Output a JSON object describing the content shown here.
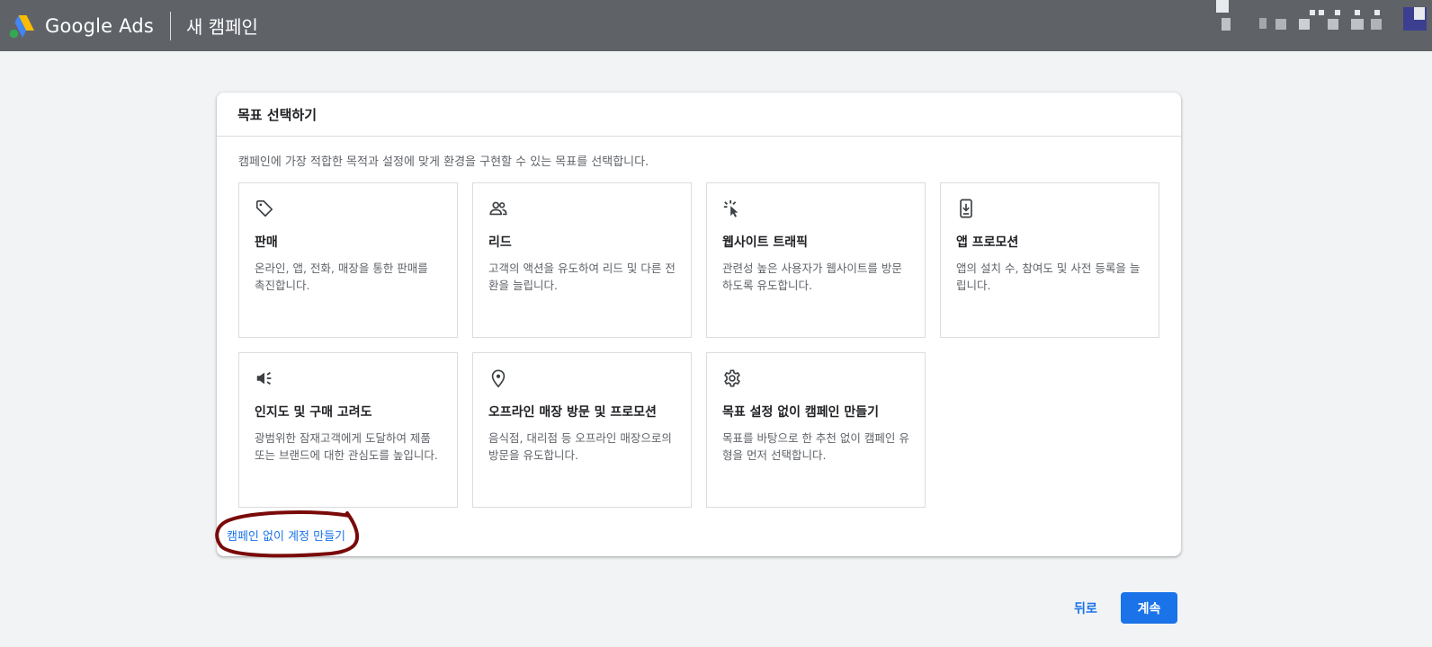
{
  "header": {
    "brand": "Google Ads",
    "subtitle": "새 캠페인"
  },
  "card": {
    "title": "목표 선택하기",
    "description": "캠페인에 가장 적합한 목적과 설정에 맞게 환경을 구현할 수 있는 목표를 선택합니다.",
    "goals": [
      {
        "icon": "tag-icon",
        "title": "판매",
        "text": "온라인, 앱, 전화, 매장을 통한 판매를 촉진합니다."
      },
      {
        "icon": "people-icon",
        "title": "리드",
        "text": "고객의 액션을 유도하여 리드 및 다른 전환을 늘립니다."
      },
      {
        "icon": "cursor-click-icon",
        "title": "웹사이트 트래픽",
        "text": "관련성 높은 사용자가 웹사이트를 방문하도록 유도합니다."
      },
      {
        "icon": "phone-download-icon",
        "title": "앱 프로모션",
        "text": "앱의 설치 수, 참여도 및 사전 등록을 늘립니다."
      },
      {
        "icon": "megaphone-icon",
        "title": "인지도 및 구매 고려도",
        "text": "광범위한 잠재고객에게 도달하여 제품 또는 브랜드에 대한 관심도를 높입니다."
      },
      {
        "icon": "location-pin-icon",
        "title": "오프라인 매장 방문 및 프로모션",
        "text": "음식점, 대리점 등 오프라인 매장으로의 방문을 유도합니다."
      },
      {
        "icon": "gear-icon",
        "title": "목표 설정 없이 캠페인 만들기",
        "text": "목표를 바탕으로 한 추천 없이 캠페인 유형을 먼저 선택합니다."
      }
    ],
    "create_account_link": "캠페인 없이 계정 만들기"
  },
  "footer": {
    "back_label": "뒤로",
    "continue_label": "계속"
  },
  "colors": {
    "topbar": "#5f6368",
    "primary": "#1a73e8",
    "annotation": "#7a0a0a"
  }
}
